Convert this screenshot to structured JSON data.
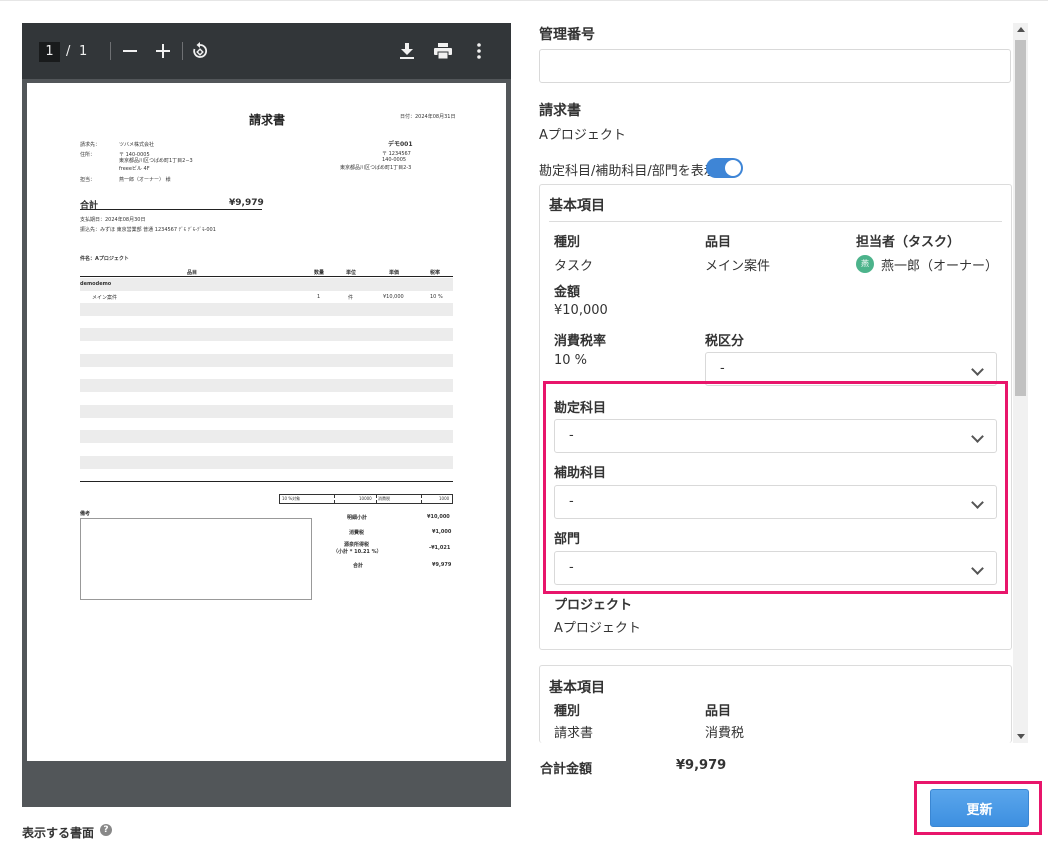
{
  "viewer": {
    "page_current": "1",
    "page_sep": "/",
    "page_total": "1",
    "zoom_out": "−",
    "zoom_in": "+"
  },
  "invoice": {
    "title": "請求書",
    "date": "日付：2024年08月31日",
    "to_label": "請求先：",
    "to_value": "ツバメ株式会社",
    "address_label": "住所：",
    "address_line1": "〒 140-0005",
    "address_line2": "東京都品川区つばめ町1丁目2−3",
    "address_line3": "freeeビル 4F",
    "person_label": "担当：",
    "person_value": "燕一郎（オーナー） 様",
    "issuer_name": "デモ001",
    "issuer_line1": "〒 1234567",
    "issuer_line2": "140-0005",
    "issuer_line3": "東京都品川区つばめ町1丁目2-3",
    "total_label": "合計",
    "total_value": "¥9,979",
    "due_date": "支払期日：2024年08月30日",
    "bank": "振込先：みずほ 東京営業部 普通 1234567 ﾃﾞﾓ ﾃﾞﾓ-ﾃﾞﾓ-001",
    "subject": "件名：Aプロジェクト",
    "col_item": "品目",
    "col_qty": "数量",
    "col_unit": "単位",
    "col_price": "単価",
    "col_tax": "税率",
    "group_name": "demodemo",
    "row_item": "メイン案件",
    "row_qty": "1",
    "row_unit": "件",
    "row_price": "¥10,000",
    "row_tax": "10 %",
    "tax_target_label": "10 %対象",
    "tax_target_value": "10000",
    "tax_label": "消費税",
    "tax_value": "1000",
    "notes_label": "備考",
    "subtotal_label": "明細小計",
    "subtotal_value": "¥10,000",
    "consumption_label": "消費税",
    "consumption_value": "¥1,000",
    "withholding_label1": "源泉所得税",
    "withholding_label2": "（小計 * 10.21 %）",
    "withholding_value": "-¥1,021",
    "grand_label": "合計",
    "grand_value": "¥9,979"
  },
  "left_footer": {
    "doc_label": "表示する書面",
    "help": "?"
  },
  "form": {
    "mgmt_no_label": "管理番号",
    "mgmt_no_value": "",
    "doc_type_label": "請求書",
    "doc_type_value": "Aプロジェクト",
    "toggle_label": "勘定科目/補助科目/部門を表示",
    "toggle_on": true
  },
  "card1": {
    "title": "基本項目",
    "type_label": "種別",
    "type_value": "タスク",
    "item_label": "品目",
    "item_value": "メイン案件",
    "assignee_label": "担当者（タスク）",
    "assignee_avatar": "燕",
    "assignee_value": "燕一郎（オーナー）",
    "amount_label": "金額",
    "amount_value": "¥10,000",
    "taxrate_label": "消費税率",
    "taxrate_value": "10 %",
    "taxclass_label": "税区分",
    "taxclass_value": "-",
    "account_label": "勘定科目",
    "account_value": "-",
    "subaccount_label": "補助科目",
    "subaccount_value": "-",
    "dept_label": "部門",
    "dept_value": "-",
    "project_label": "プロジェクト",
    "project_value": "Aプロジェクト"
  },
  "card2": {
    "title": "基本項目",
    "type_label": "種別",
    "type_value": "請求書",
    "item_label": "品目",
    "item_value": "消費税"
  },
  "footer": {
    "total_label": "合計金額",
    "total_value": "¥9,979",
    "update_label": "更新"
  },
  "colors": {
    "accent": "#3e85d6",
    "highlight": "#e8156b",
    "toolbar": "#323639",
    "viewer_bg": "#525659"
  }
}
